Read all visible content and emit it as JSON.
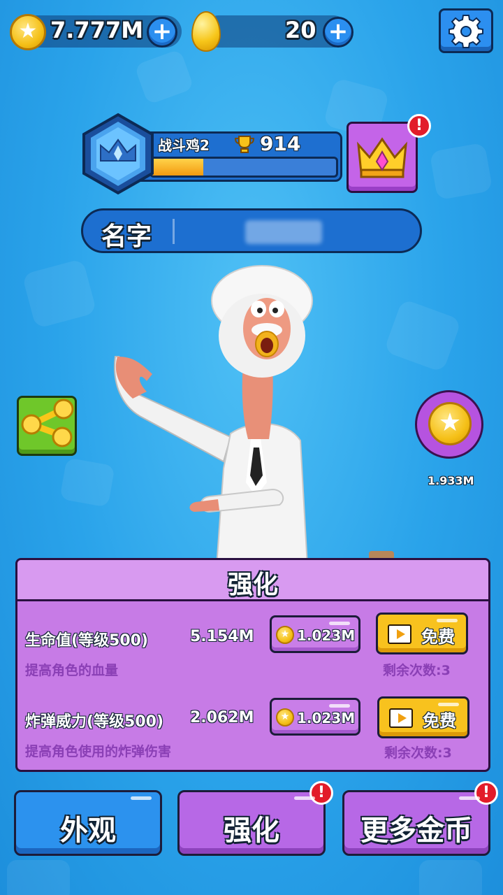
{
  "hud": {
    "coins_value": "7.777M",
    "gems_value": "20",
    "plus_glyph": "+",
    "coin_icon": "star-coin-icon",
    "gem_icon": "gold-egg-icon",
    "settings_icon": "gear-icon"
  },
  "profile": {
    "rank_name": "战斗鸡2",
    "trophies": "914",
    "trophy_icon": "trophy-icon",
    "progress": 0.28,
    "name_label": "名字",
    "crown_alert": "!"
  },
  "side": {
    "share_icon": "share-icon",
    "collect_value": "1.933M"
  },
  "upgrade_panel": {
    "title": "强化",
    "rows": [
      {
        "name": "生命值(等级500)",
        "value": "5.154M",
        "desc": "提高角色的血量",
        "cost": "1.023M",
        "free_label": "免费",
        "remaining": "剩余次数:3"
      },
      {
        "name": "炸弹威力(等级500)",
        "value": "2.062M",
        "desc": "提高角色使用的炸弹伤害",
        "cost": "1.023M",
        "free_label": "免费",
        "remaining": "剩余次数:3"
      }
    ]
  },
  "bottom_nav": {
    "appearance": "外观",
    "upgrade": "强化",
    "more_coins": "更多金币",
    "alert": "!"
  },
  "colors": {
    "bg": "#2aa3ea",
    "panel": "#c77be6",
    "free_button": "#f8c21e",
    "nav_blue": "#2c92ee",
    "nav_purple": "#b768e6"
  }
}
